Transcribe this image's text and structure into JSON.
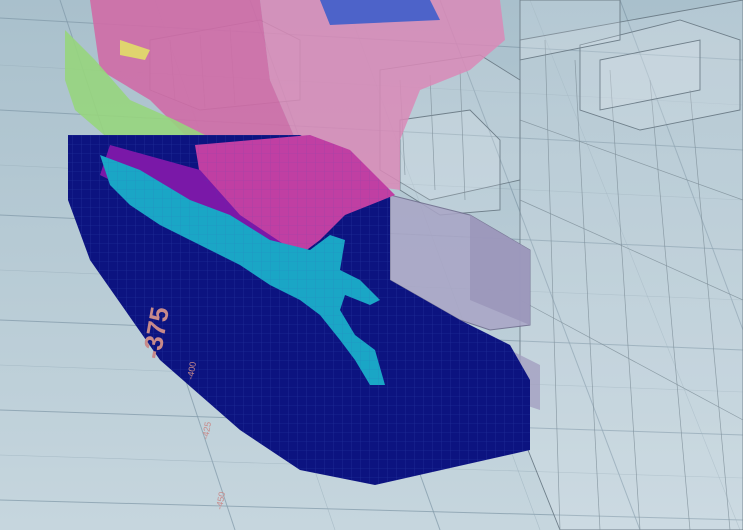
{
  "scene": {
    "colors": {
      "ground": "#b9ccd6",
      "deep_block": "#0c1380",
      "cyan_vein": "#1aa6c6",
      "magenta": "#c03fa3",
      "purple": "#7a18a8",
      "pink_translucent": "#d98ab7",
      "lime": "#8fd27a",
      "lavender_block": "#a7a3c3"
    },
    "axis_labels": {
      "major": "-375",
      "minor_1": "-400",
      "minor_2": "-425",
      "minor_3": "-450"
    }
  }
}
